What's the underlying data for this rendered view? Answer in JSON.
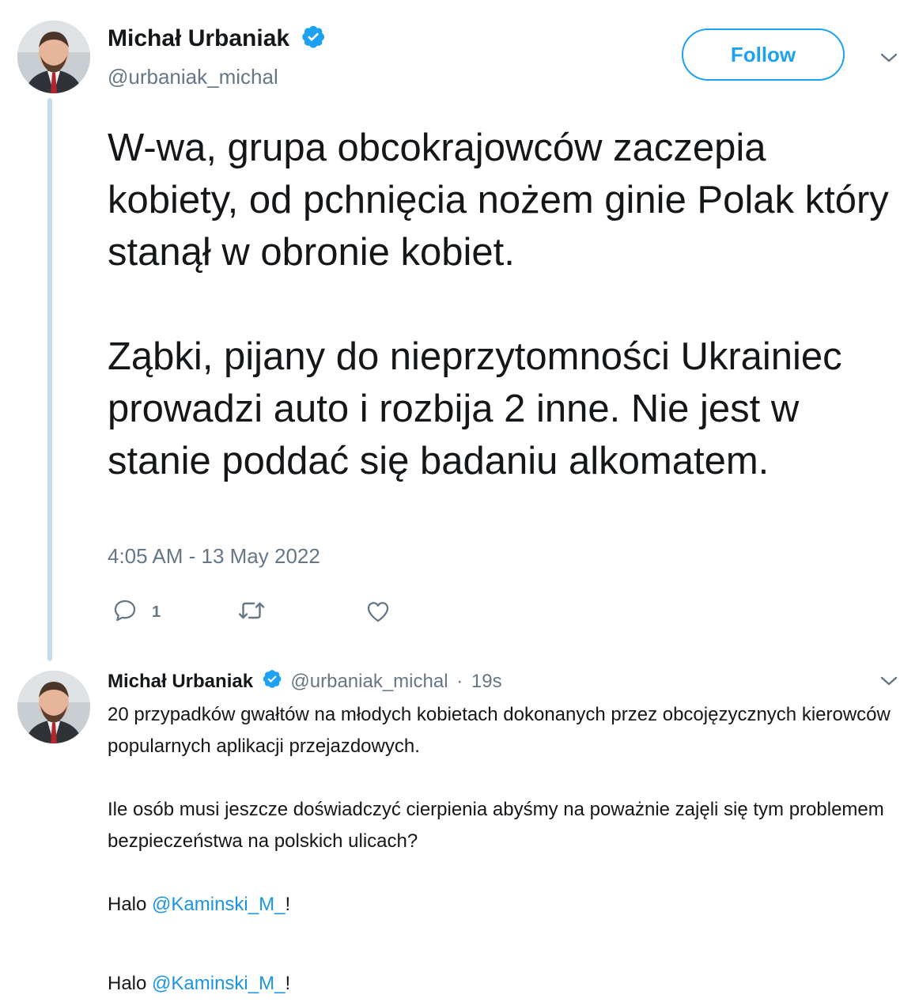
{
  "tweet": {
    "author": {
      "name": "Michał Urbaniak",
      "handle": "@urbaniak_michal",
      "verified": true
    },
    "follow_label": "Follow",
    "text_paragraphs": [
      "W-wa, grupa obcokrajowców zaczepia kobiety, od pchnięcia nożem ginie Polak który stanął w obronie kobiet.",
      "Ząbki, pijany do nieprzytomności Ukrainiec prowadzi auto i rozbija 2 inne. Nie jest w stanie poddać się badaniu alkomatem."
    ],
    "timestamp": "4:05 AM - 13 May 2022",
    "actions": {
      "reply_icon": "reply-icon",
      "reply_count": "1",
      "retweet_icon": "retweet-icon",
      "like_icon": "like-icon"
    }
  },
  "reply": {
    "author": {
      "name": "Michał Urbaniak",
      "handle": "@urbaniak_michal",
      "separator": "·",
      "time": "19s",
      "verified": true
    },
    "paragraph1": "20 przypadków gwałtów na młodych kobietach dokonanych przez obcojęzycznych kierowców popularnych aplikacji przejazdowych.",
    "paragraph2": "Ile osób musi jeszcze doświadczyć cierpienia abyśmy na poważnie zajęli się tym problemem bezpieczeństwa na polskich ulicach?",
    "halo_lines": [
      {
        "prefix": "Halo ",
        "mention": "@Kaminski_M_",
        "suffix": "!"
      },
      {
        "prefix": "Halo ",
        "mention": "@Kaminski_M_",
        "suffix": "!"
      }
    ]
  },
  "colors": {
    "accent": "#1da1f2",
    "secondary_text": "#657786",
    "thread_line": "#c4dcf0"
  }
}
